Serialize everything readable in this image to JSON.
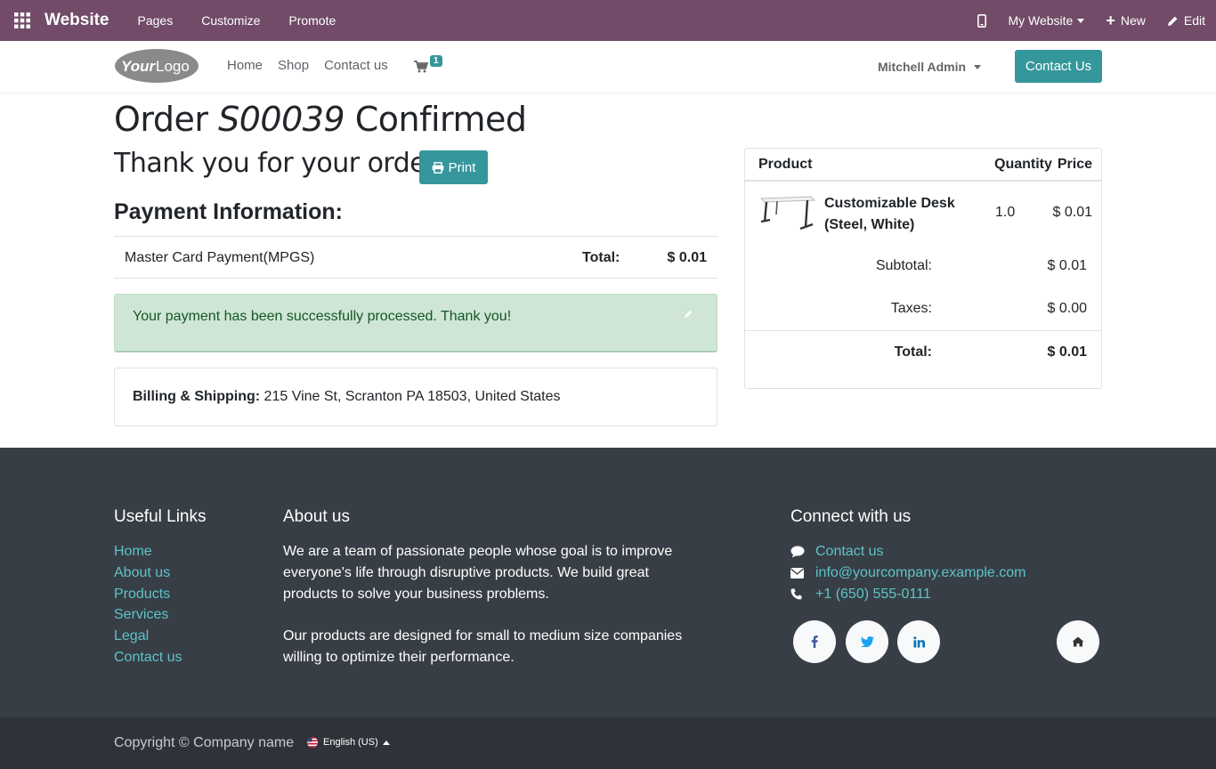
{
  "adminbar": {
    "brand": "Website",
    "menu": [
      "Pages",
      "Customize",
      "Promote"
    ],
    "site_selector": "My Website",
    "new_label": "New",
    "edit_label": "Edit"
  },
  "header": {
    "logo_text": "YourLogo",
    "nav": [
      "Home",
      "Shop",
      "Contact us"
    ],
    "cart_count": "1",
    "user_name": "Mitchell Admin",
    "contact_button": "Contact Us"
  },
  "order": {
    "title_prefix": "Order",
    "order_number": "S00039",
    "title_suffix": "Confirmed",
    "thank_you": "Thank you for your order.",
    "print_label": "Print",
    "payment_heading": "Payment Information:",
    "payment_method": "Master Card Payment(MPGS)",
    "total_label": "Total:",
    "total_value": "$ 0.01",
    "success_message": "Your payment has been successfully processed. Thank you!",
    "billing_label": "Billing & Shipping:",
    "billing_address": "215 Vine St, Scranton PA 18503, United States"
  },
  "summary": {
    "col_product": "Product",
    "col_quantity": "Quantity",
    "col_price": "Price",
    "line_name_1": "Customizable Desk",
    "line_name_2": "(Steel, White)",
    "line_qty": "1.0",
    "line_price": "$ 0.01",
    "subtotal_label": "Subtotal:",
    "subtotal_value": "$ 0.01",
    "taxes_label": "Taxes:",
    "taxes_value": "$ 0.00",
    "total_label": "Total:",
    "total_value": "$ 0.01"
  },
  "footer": {
    "useful_links_title": "Useful Links",
    "useful_links": [
      "Home",
      "About us",
      "Products",
      "Services",
      "Legal",
      "Contact us"
    ],
    "about_title": "About us",
    "about_p1": "We are a team of passionate people whose goal is to improve everyone's life through disruptive products. We build great products to solve your business problems.",
    "about_p2": "Our products are designed for small to medium size companies willing to optimize their performance.",
    "connect_title": "Connect with us",
    "connect_contact": "Contact us",
    "connect_email": "info@yourcompany.example.com",
    "connect_phone": "+1 (650) 555-0111",
    "copyright": "Copyright © Company name",
    "language": "English (US)"
  },
  "colors": {
    "admin_bar": "#714B67",
    "accent": "#35979C",
    "footer_bg": "#383e45",
    "link": "#5cc4c9",
    "success_bg": "#cfe6d6"
  }
}
